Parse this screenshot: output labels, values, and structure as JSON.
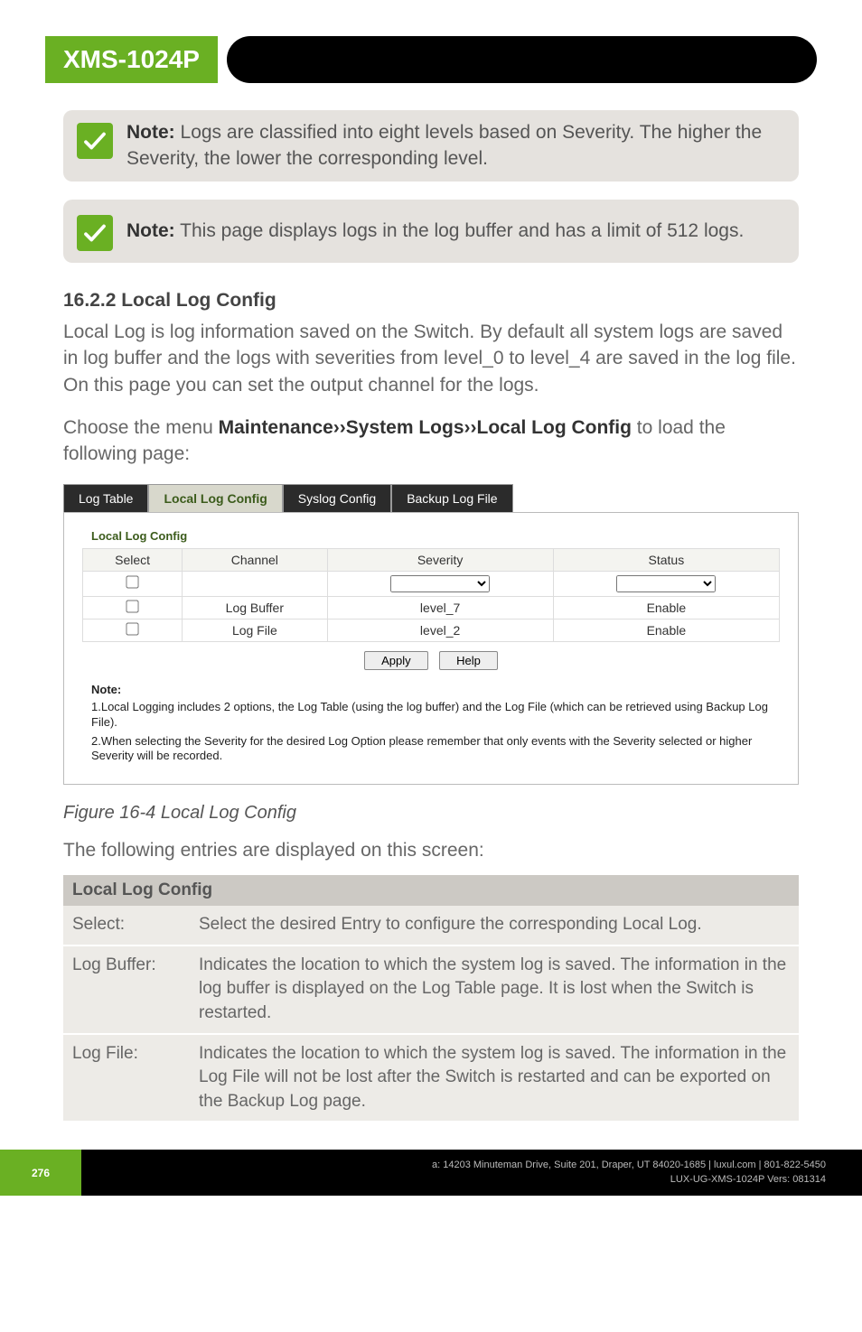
{
  "header": {
    "product": "XMS-1024P"
  },
  "notes": [
    {
      "label": "Note:",
      "text": "Logs are classified into eight levels based on Severity. The higher the Severity, the lower the corresponding level."
    },
    {
      "label": "Note:",
      "text": "This page displays logs in the log buffer and has a limit of 512 logs."
    }
  ],
  "section": {
    "heading": "16.2.2 Local Log Config",
    "para1": "Local Log is log information saved on the Switch. By default all system logs are saved in log buffer and the logs with severities from level_0 to level_4 are saved in the log file. On this page you can set the output channel for the logs.",
    "para2_pre": "Choose the menu ",
    "para2_strong": "Maintenance››System Logs››Local Log Config",
    "para2_post": " to load the following page:"
  },
  "screenshot": {
    "tabs": [
      "Log Table",
      "Local Log Config",
      "Syslog Config",
      "Backup Log File"
    ],
    "active_tab_index": 1,
    "panel_title": "Local Log Config",
    "columns": [
      "Select",
      "Channel",
      "Severity",
      "Status"
    ],
    "rows": [
      {
        "channel": "",
        "severity_select": "",
        "status_select": ""
      },
      {
        "channel": "Log Buffer",
        "severity": "level_7",
        "status": "Enable"
      },
      {
        "channel": "Log File",
        "severity": "level_2",
        "status": "Enable"
      }
    ],
    "buttons": {
      "apply": "Apply",
      "help": "Help"
    },
    "note_heading": "Note:",
    "note_lines": [
      "1.Local Logging includes 2 options, the Log Table (using the log buffer) and the Log File (which can be retrieved using Backup Log File).",
      "2.When selecting the Severity for the desired Log Option please remember that only events with the Severity selected or higher Severity will be recorded."
    ]
  },
  "figure_caption": "Figure 16-4 Local Log Config",
  "entries_intro": "The following entries are displayed on this screen:",
  "desc_table": {
    "header": "Local Log Config",
    "rows": [
      {
        "label": "Select:",
        "desc": "Select the desired Entry to configure the corresponding Local Log."
      },
      {
        "label": "Log Buffer:",
        "desc": "Indicates the location to which the system log is saved. The information in the log buffer is displayed on the Log Table page. It is lost when the Switch is restarted."
      },
      {
        "label": "Log File:",
        "desc": "Indicates the location to which the system log is saved. The information in the Log File will not be lost after the Switch is restarted and can be exported on the Backup Log page."
      }
    ]
  },
  "footer": {
    "page": "276",
    "line1": "a: 14203 Minuteman Drive, Suite 201, Draper, UT 84020-1685 | luxul.com | 801-822-5450",
    "line2": "LUX-UG-XMS-1024P  Vers: 081314"
  }
}
